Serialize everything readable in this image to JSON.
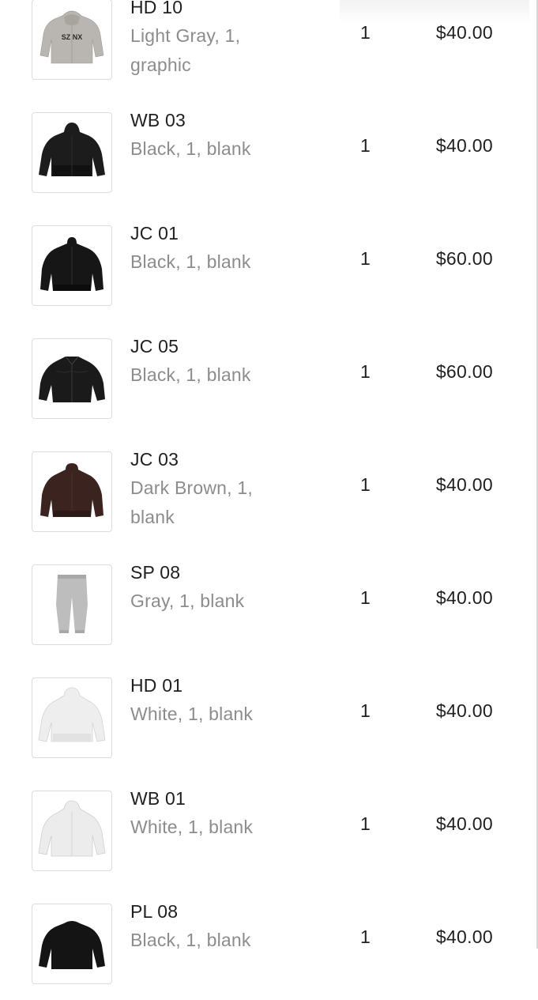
{
  "items": [
    {
      "name": "HD 10",
      "variant": "Light Gray, 1, graphic",
      "qty": "1",
      "price": "$40.00",
      "image_icon": "hoodie-graphic-icon",
      "color": "#b9b6b1",
      "graphic_text": "SZ NX"
    },
    {
      "name": "WB 03",
      "variant": "Black, 1, blank",
      "qty": "1",
      "price": "$40.00",
      "image_icon": "windbreaker-icon",
      "color": "#1c1c1c"
    },
    {
      "name": "JC 01",
      "variant": "Black, 1, blank",
      "qty": "1",
      "price": "$60.00",
      "image_icon": "jacket-icon",
      "color": "#161616"
    },
    {
      "name": "JC 05",
      "variant": "Black, 1, blank",
      "qty": "1",
      "price": "$60.00",
      "image_icon": "leather-jacket-icon",
      "color": "#1a1a1a"
    },
    {
      "name": "JC 03",
      "variant": "Dark Brown, 1, blank",
      "qty": "1",
      "price": "$40.00",
      "image_icon": "jacket-icon",
      "color": "#3b2420"
    },
    {
      "name": "SP 08",
      "variant": "Gray, 1, blank",
      "qty": "1",
      "price": "$40.00",
      "image_icon": "sweatpants-icon",
      "color": "#bdbdbd"
    },
    {
      "name": "HD 01",
      "variant": "White, 1, blank",
      "qty": "1",
      "price": "$40.00",
      "image_icon": "hoodie-icon",
      "color": "#eeeeee"
    },
    {
      "name": "WB 01",
      "variant": "White, 1, blank",
      "qty": "1",
      "price": "$40.00",
      "image_icon": "windbreaker-icon",
      "color": "#ececec"
    },
    {
      "name": "PL 08",
      "variant": "Black, 1, blank",
      "qty": "1",
      "price": "$40.00",
      "image_icon": "pullover-icon",
      "color": "#141414"
    }
  ]
}
